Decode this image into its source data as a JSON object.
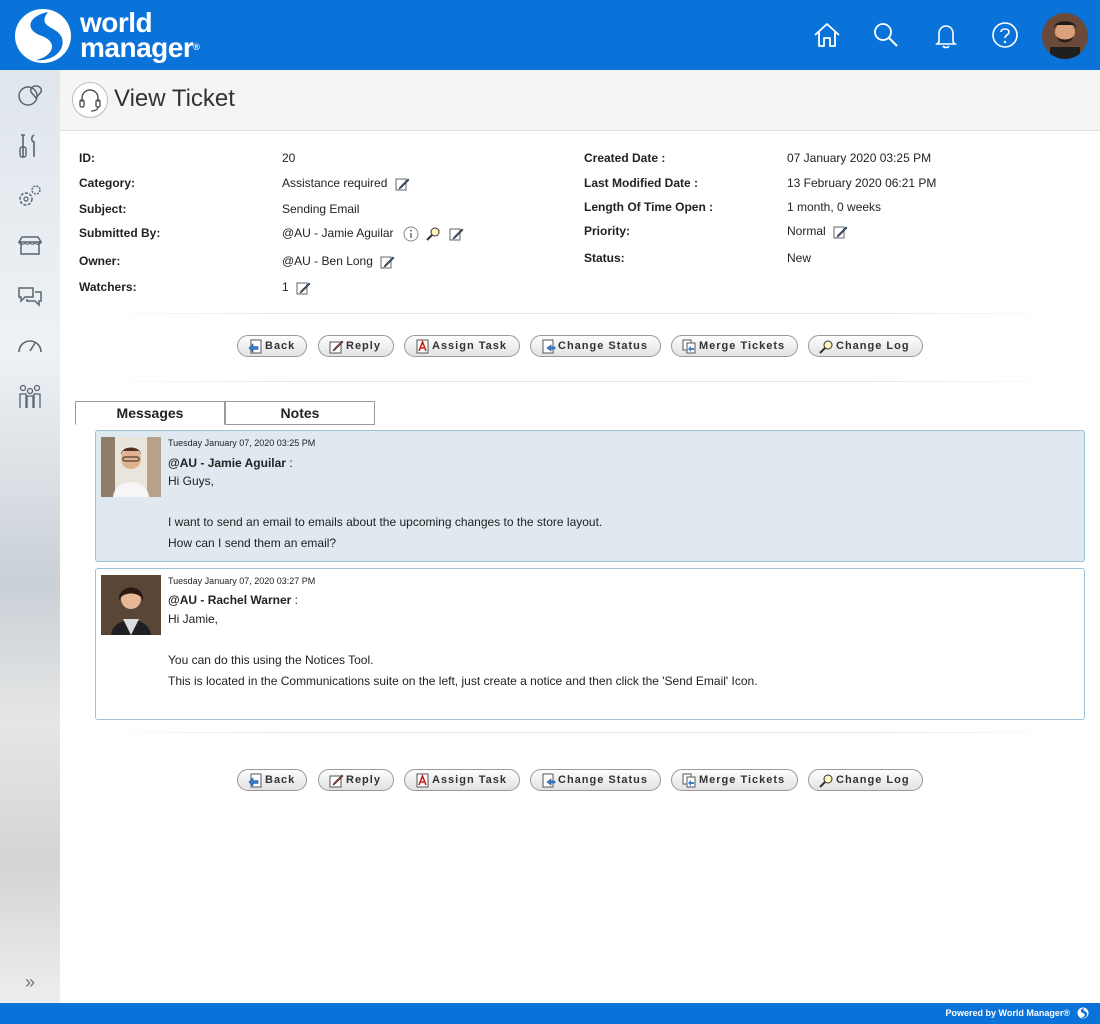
{
  "brand": {
    "line1": "world",
    "line2": "manager",
    "reg": "®"
  },
  "page": {
    "title": "View Ticket"
  },
  "ticket": {
    "id_label": "ID:",
    "id_value": "20",
    "category_label": "Category:",
    "category_value": "Assistance required",
    "subject_label": "Subject:",
    "subject_value": "Sending Email",
    "submitted_label": "Submitted By:",
    "submitted_value": "@AU - Jamie Aguilar",
    "owner_label": "Owner:",
    "owner_value": "@AU - Ben Long",
    "watchers_label": "Watchers:",
    "watchers_value": "1",
    "created_label": "Created Date :",
    "created_value": "07 January 2020 03:25 PM",
    "modified_label": "Last Modified Date :",
    "modified_value": "13 February 2020 06:21 PM",
    "open_label": "Length Of Time Open :",
    "open_value": "1 month, 0 weeks",
    "priority_label": "Priority:",
    "priority_value": "Normal",
    "status_label": "Status:",
    "status_value": "New"
  },
  "actions": {
    "back": "Back",
    "reply": "Reply",
    "assign": "Assign Task",
    "status": "Change Status",
    "merge": "Merge Tickets",
    "log": "Change Log"
  },
  "tabs": {
    "messages": "Messages",
    "notes": "Notes"
  },
  "messages": [
    {
      "time": "Tuesday January 07, 2020 03:25 PM",
      "author": "@AU - Jamie Aguilar",
      "lines": [
        "Hi Guys,",
        "",
        "I want to send an email to emails about the upcoming changes to the store layout.",
        "How can I send them an email?"
      ]
    },
    {
      "time": "Tuesday January 07, 2020 03:27 PM",
      "author": "@AU - Rachel Warner",
      "lines": [
        "Hi Jamie,",
        "",
        "You can do this using the Notices Tool.",
        "This is located in the Communications suite on the left, just create a notice and then click the 'Send Email' Icon."
      ]
    }
  ],
  "footer": {
    "text": "Powered by World Manager®"
  },
  "colors": {
    "brand": "#0a73d9",
    "message_highlight": "#dfe9ef",
    "message_border": "#9ec3d9"
  }
}
